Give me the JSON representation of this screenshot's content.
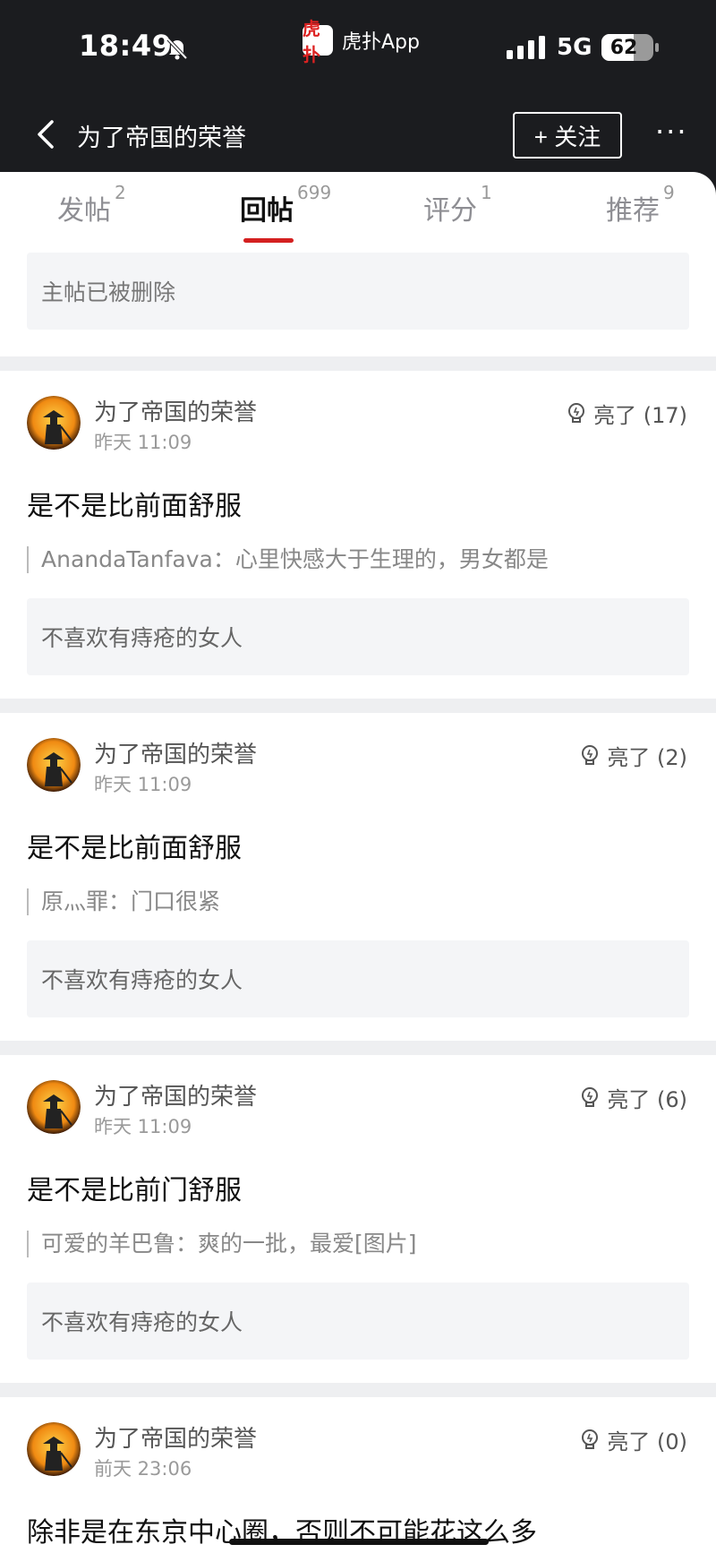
{
  "status_bar": {
    "time": "18:49",
    "app_name": "虎扑App",
    "app_logo_text": "虎扑",
    "network": "5G",
    "battery": "62",
    "battery_level": 0.62
  },
  "nav": {
    "title": "为了帝国的荣誉",
    "follow_label": "+ 关注",
    "more_label": "···"
  },
  "tabs": [
    {
      "label": "发帖",
      "count": "2"
    },
    {
      "label": "回帖",
      "count": "699"
    },
    {
      "label": "评分",
      "count": "1"
    },
    {
      "label": "推荐",
      "count": "9"
    }
  ],
  "notice": "主帖已被删除",
  "posts": [
    {
      "username": "为了帝国的荣誉",
      "time": "昨天 11:09",
      "likes": "亮了 (17)",
      "text": "是不是比前面舒服",
      "quote_author": "AnandaTanfava",
      "quote_text": "：心里快感大于生理的，男女都是",
      "reply": "不喜欢有痔疮的女人"
    },
    {
      "username": "为了帝国的荣誉",
      "time": "昨天 11:09",
      "likes": "亮了 (2)",
      "text": "是不是比前面舒服",
      "quote_author": "原灬罪",
      "quote_text": "：门口很紧",
      "reply": "不喜欢有痔疮的女人"
    },
    {
      "username": "为了帝国的荣誉",
      "time": "昨天 11:09",
      "likes": "亮了 (6)",
      "text": "是不是比前门舒服",
      "quote_author": "可爱的羊巴鲁",
      "quote_text": "：爽的一批，最爱[图片]",
      "reply": "不喜欢有痔疮的女人"
    },
    {
      "username": "为了帝国的荣誉",
      "time": "前天 23:06",
      "likes": "亮了 (0)",
      "text": "除非是在东京中心圈，否则不可能花这么多"
    }
  ],
  "colors": {
    "accent": "#d42020",
    "header_bg": "#1b1c1f",
    "card_bg": "#f4f5f7"
  }
}
